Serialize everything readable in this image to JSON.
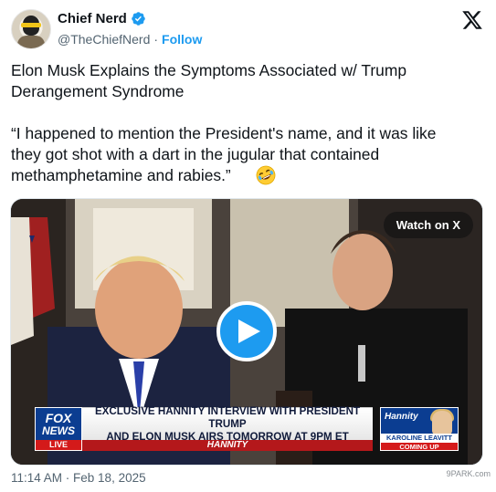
{
  "author": {
    "display_name": "Chief Nerd",
    "handle": "@TheChiefNerd",
    "separator": "·",
    "follow_label": "Follow"
  },
  "tweet": {
    "text": "Elon Musk Explains the Symptoms Associated w/ Trump\nDerangement Syndrome\n\n“I happened to mention the President's name, and it was like\nthey got shot with a dart in the jugular that contained\nmethamphetamine and rabies.”",
    "emoji": "rolling-on-floor-laughing"
  },
  "media": {
    "watch_label": "Watch on X",
    "chyron": {
      "network_line1": "FOX",
      "network_line2": "NEWS",
      "live": "LIVE",
      "headline_line1": "EXCLUSIVE HANNITY INTERVIEW WITH PRESIDENT TRUMP",
      "headline_line2": "AND ELON MUSK AIRS TOMORROW AT 9PM ET",
      "show": "HANNITY",
      "side_brand": "Hannity",
      "side_name": "KAROLINE LEAVITT",
      "side_status": "COMING UP"
    }
  },
  "footer": {
    "timestamp": "11:14 AM · Feb 18, 2025"
  },
  "colors": {
    "accent": "#1d9bf0",
    "text": "#0f1419",
    "muted": "#536471"
  },
  "watermark": "9PARK.com"
}
